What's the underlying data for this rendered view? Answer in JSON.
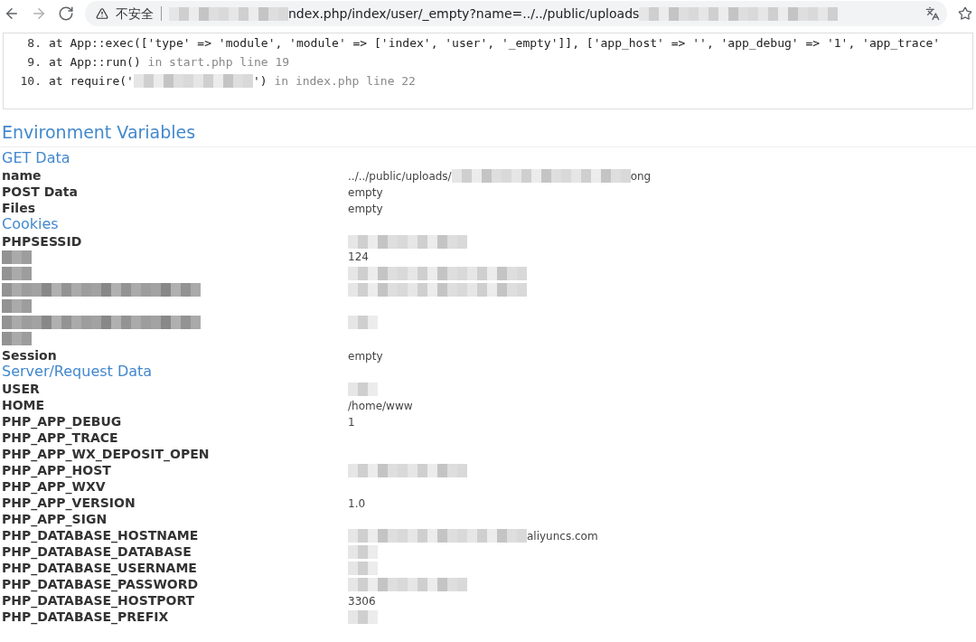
{
  "browser": {
    "security_label": "不安全",
    "url": [
      {
        "kind": "redacted_medium"
      },
      {
        "kind": "text",
        "text": "ndex.php/index/user/_empty?name=../../public/uploads"
      },
      {
        "kind": "redacted_wide"
      }
    ]
  },
  "trace": [
    {
      "number": "8.",
      "segments": [
        {
          "kind": "code",
          "text": "at App::exec(['type' => 'module', 'module' => ['index', 'user', '_empty']], ['app_host' => '', 'app_debug' => '1', 'app_trace'"
        }
      ]
    },
    {
      "number": "9.",
      "segments": [
        {
          "kind": "code",
          "text": "at App::run()"
        },
        {
          "kind": "file",
          "text": " in start.php line 19"
        }
      ]
    },
    {
      "number": "10.",
      "segments": [
        {
          "kind": "code",
          "text": "at require('"
        },
        {
          "kind": "redacted_medium"
        },
        {
          "kind": "code",
          "text": "')"
        },
        {
          "kind": "file",
          "text": " in index.php line 22"
        }
      ]
    }
  ],
  "environment": {
    "title": "Environment Variables",
    "blocks": [
      {
        "kind": "heading",
        "text": "GET Data"
      },
      {
        "kind": "row",
        "key": [
          {
            "kind": "text",
            "text": "name"
          }
        ],
        "value": [
          {
            "kind": "text",
            "text": "../../public/uploads/"
          },
          {
            "kind": "redacted_long"
          },
          {
            "kind": "text",
            "text": "ong"
          }
        ]
      },
      {
        "kind": "row",
        "key": [
          {
            "kind": "text",
            "text": "POST Data"
          }
        ],
        "value": [
          {
            "kind": "text",
            "text": "empty"
          }
        ]
      },
      {
        "kind": "row",
        "key": [
          {
            "kind": "text",
            "text": "Files"
          }
        ],
        "value": [
          {
            "kind": "text",
            "text": "empty"
          }
        ]
      },
      {
        "kind": "heading",
        "text": "Cookies"
      },
      {
        "kind": "row",
        "key": [
          {
            "kind": "text",
            "text": "PHPSESSID"
          }
        ],
        "value": [
          {
            "kind": "redacted_medium"
          }
        ]
      },
      {
        "kind": "row",
        "key": [
          {
            "kind": "redacted_short"
          }
        ],
        "value": [
          {
            "kind": "text",
            "text": "124"
          }
        ]
      },
      {
        "kind": "row",
        "key": [
          {
            "kind": "redacted_short"
          }
        ],
        "value": [
          {
            "kind": "redacted_long"
          }
        ]
      },
      {
        "kind": "row",
        "key": [
          {
            "kind": "redacted_wide"
          }
        ],
        "value": [
          {
            "kind": "redacted_long"
          }
        ]
      },
      {
        "kind": "row",
        "key": [
          {
            "kind": "redacted_short"
          }
        ]
      },
      {
        "kind": "row",
        "key": [
          {
            "kind": "redacted_wide"
          }
        ],
        "value": [
          {
            "kind": "redacted_short"
          }
        ]
      },
      {
        "kind": "row",
        "key": [
          {
            "kind": "redacted_short"
          }
        ]
      },
      {
        "kind": "row",
        "key": [
          {
            "kind": "text",
            "text": "Session"
          }
        ],
        "value": [
          {
            "kind": "text",
            "text": "empty"
          }
        ]
      },
      {
        "kind": "heading",
        "text": "Server/Request Data"
      },
      {
        "kind": "row",
        "key": [
          {
            "kind": "text",
            "text": "USER"
          }
        ],
        "value": [
          {
            "kind": "redacted_short"
          }
        ]
      },
      {
        "kind": "row",
        "key": [
          {
            "kind": "text",
            "text": "HOME"
          }
        ],
        "value": [
          {
            "kind": "text",
            "text": "/home/www"
          }
        ]
      },
      {
        "kind": "row",
        "key": [
          {
            "kind": "text",
            "text": "PHP_APP_DEBUG"
          }
        ],
        "value": [
          {
            "kind": "text",
            "text": "1"
          }
        ]
      },
      {
        "kind": "row",
        "key": [
          {
            "kind": "text",
            "text": "PHP_APP_TRACE"
          }
        ]
      },
      {
        "kind": "row",
        "key": [
          {
            "kind": "text",
            "text": "PHP_APP_WX_DEPOSIT_OPEN"
          }
        ]
      },
      {
        "kind": "row",
        "key": [
          {
            "kind": "text",
            "text": "PHP_APP_HOST"
          }
        ],
        "value": [
          {
            "kind": "redacted_medium"
          }
        ]
      },
      {
        "kind": "row",
        "key": [
          {
            "kind": "text",
            "text": "PHP_APP_WXV"
          }
        ]
      },
      {
        "kind": "row",
        "key": [
          {
            "kind": "text",
            "text": "PHP_APP_VERSION"
          }
        ],
        "value": [
          {
            "kind": "text",
            "text": "1.0"
          }
        ]
      },
      {
        "kind": "row",
        "key": [
          {
            "kind": "text",
            "text": "PHP_APP_SIGN"
          }
        ]
      },
      {
        "kind": "row",
        "key": [
          {
            "kind": "text",
            "text": "PHP_DATABASE_HOSTNAME"
          }
        ],
        "value": [
          {
            "kind": "redacted_long"
          },
          {
            "kind": "text",
            "text": "aliyuncs.com"
          }
        ]
      },
      {
        "kind": "row",
        "key": [
          {
            "kind": "text",
            "text": "PHP_DATABASE_DATABASE"
          }
        ],
        "value": [
          {
            "kind": "redacted_short"
          }
        ]
      },
      {
        "kind": "row",
        "key": [
          {
            "kind": "text",
            "text": "PHP_DATABASE_USERNAME"
          }
        ],
        "value": [
          {
            "kind": "redacted_short"
          }
        ]
      },
      {
        "kind": "row",
        "key": [
          {
            "kind": "text",
            "text": "PHP_DATABASE_PASSWORD"
          }
        ],
        "value": [
          {
            "kind": "redacted_medium"
          }
        ]
      },
      {
        "kind": "row",
        "key": [
          {
            "kind": "text",
            "text": "PHP_DATABASE_HOSTPORT"
          }
        ],
        "value": [
          {
            "kind": "text",
            "text": "3306"
          }
        ]
      },
      {
        "kind": "row",
        "key": [
          {
            "kind": "text",
            "text": "PHP_DATABASE_PREFIX"
          }
        ],
        "value": [
          {
            "kind": "redacted_short"
          }
        ]
      }
    ]
  }
}
